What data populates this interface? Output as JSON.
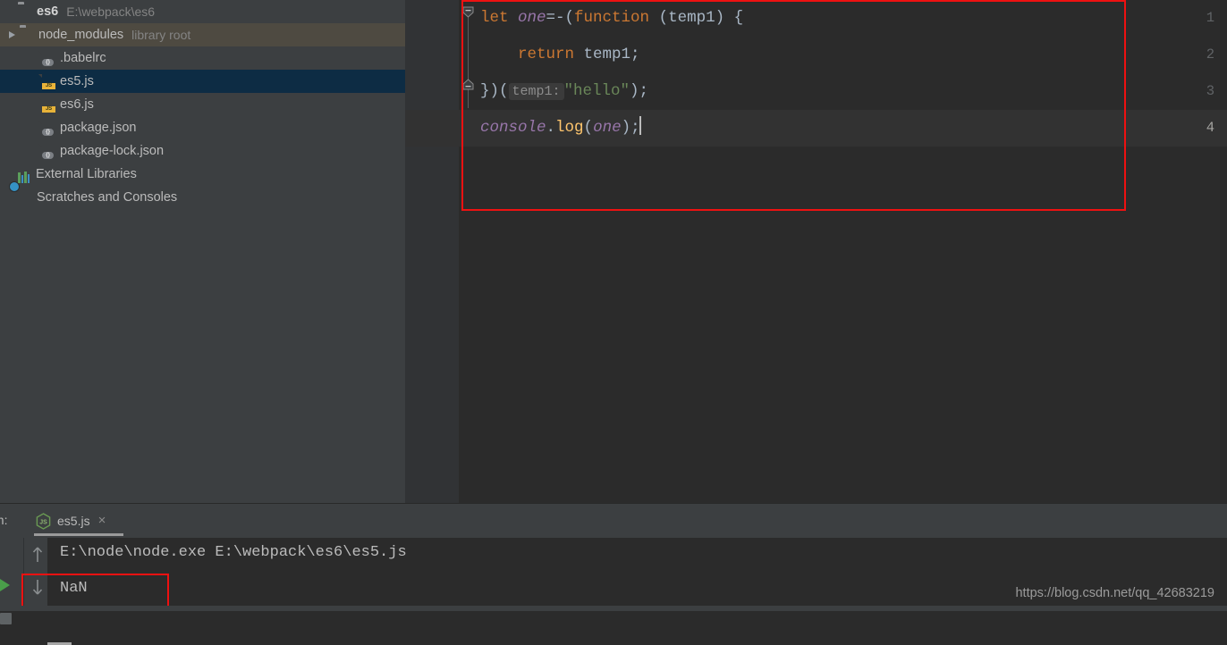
{
  "sidebar": {
    "items": [
      {
        "label": "es6",
        "sub": "E:\\webpack\\es6",
        "icon": "folder-icon",
        "kind": "project",
        "state": "normal",
        "indent": 0,
        "arrow": "none"
      },
      {
        "label": "node_modules",
        "sub": "library root",
        "icon": "folder-icon",
        "kind": "folder",
        "state": "hover",
        "indent": 1,
        "arrow": "closed"
      },
      {
        "label": ".babelrc",
        "sub": "",
        "icon": "json-file-icon",
        "kind": "file",
        "state": "normal",
        "indent": 2,
        "arrow": "none"
      },
      {
        "label": "es5.js",
        "sub": "",
        "icon": "js-file-icon",
        "kind": "file",
        "state": "selected",
        "indent": 2,
        "arrow": "none"
      },
      {
        "label": "es6.js",
        "sub": "",
        "icon": "js-file-icon",
        "kind": "file",
        "state": "normal",
        "indent": 2,
        "arrow": "none"
      },
      {
        "label": "package.json",
        "sub": "",
        "icon": "json-file-icon",
        "kind": "file",
        "state": "normal",
        "indent": 2,
        "arrow": "none"
      },
      {
        "label": "package-lock.json",
        "sub": "",
        "icon": "json-file-icon",
        "kind": "file",
        "state": "normal",
        "indent": 2,
        "arrow": "none"
      },
      {
        "label": "External Libraries",
        "sub": "",
        "icon": "library-bars-icon",
        "kind": "node",
        "state": "normal",
        "indent": 0,
        "arrow": "none"
      },
      {
        "label": "Scratches and Consoles",
        "sub": "",
        "icon": "scratches-clock-icon",
        "kind": "node",
        "state": "normal",
        "indent": 0,
        "arrow": "none"
      }
    ]
  },
  "editor": {
    "line_numbers": [
      "1",
      "2",
      "3",
      "4"
    ],
    "current_line": 4,
    "lines": [
      {
        "number": "1",
        "tokens": [
          {
            "text": "let ",
            "type": "keyword"
          },
          {
            "text": "one",
            "type": "variable"
          },
          {
            "text": "=-(",
            "type": "operator"
          },
          {
            "text": "function",
            "type": "keyword"
          },
          {
            "text": " (temp1) {",
            "type": "plain"
          }
        ]
      },
      {
        "number": "2",
        "tokens": [
          {
            "text": "    ",
            "type": "plain"
          },
          {
            "text": "return",
            "type": "keyword"
          },
          {
            "text": " temp1;",
            "type": "plain"
          }
        ]
      },
      {
        "number": "3",
        "tokens": [
          {
            "text": "})(",
            "type": "plain"
          },
          {
            "text": "temp1:",
            "type": "inlay"
          },
          {
            "text": "\"hello\"",
            "type": "string"
          },
          {
            "text": ");",
            "type": "plain"
          }
        ]
      },
      {
        "number": "4",
        "tokens": [
          {
            "text": "console",
            "type": "variable"
          },
          {
            "text": ".",
            "type": "plain"
          },
          {
            "text": "log",
            "type": "function"
          },
          {
            "text": "(",
            "type": "plain"
          },
          {
            "text": "one",
            "type": "variable"
          },
          {
            "text": ");",
            "type": "plain"
          }
        ]
      }
    ],
    "plain_text": "let one=-(function (temp1) {\n    return temp1;\n})( temp1: \"hello\");\nconsole.log(one);"
  },
  "run_panel": {
    "title": "un:",
    "tab_label": "es5.js",
    "tab_close": "×",
    "console_lines": [
      "E:\\node\\node.exe E:\\webpack\\es6\\es5.js",
      "NaN"
    ]
  },
  "annotations": {
    "editor_box_color": "#ee1111",
    "console_box_color": "#ee1111"
  },
  "watermark": "https://blog.csdn.net/qq_42683219",
  "colors": {
    "sidebar_bg": "#3c3f41",
    "editor_bg": "#2b2b2b",
    "gutter_bg": "#313335",
    "current_line_bg": "#323232",
    "selection_bg": "#0d2c44",
    "hover_bg": "#4e4a41",
    "keyword": "#cc7832",
    "variable": "#9876aa",
    "string": "#6a8759",
    "function": "#ffc66d",
    "plain": "#a9b7c6"
  }
}
